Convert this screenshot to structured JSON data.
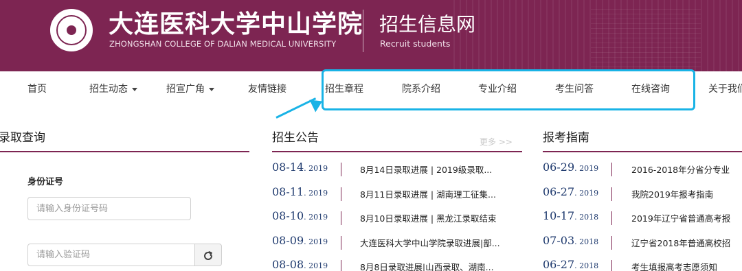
{
  "header": {
    "school_name_cn": "大连医科大学中山学院",
    "school_name_en": "ZHONGSHAN COLLEGE OF DALIAN MEDICAL UNIVERSITY",
    "site_title": "招生信息网",
    "site_subtitle": "Recruit students",
    "brand_color": "#7d2552"
  },
  "nav": {
    "items": [
      {
        "label": "首页",
        "dropdown": false
      },
      {
        "label": "招生动态",
        "dropdown": true
      },
      {
        "label": "招宣广角",
        "dropdown": true
      },
      {
        "label": "友情链接",
        "dropdown": false
      },
      {
        "label": "招生章程",
        "dropdown": false
      },
      {
        "label": "院系介绍",
        "dropdown": false
      },
      {
        "label": "专业介绍",
        "dropdown": false
      },
      {
        "label": "考生问答",
        "dropdown": false
      },
      {
        "label": "在线咨询",
        "dropdown": false
      },
      {
        "label": "关于我们",
        "dropdown": false
      }
    ],
    "highlight_color": "#19b3e6"
  },
  "query": {
    "title": "录取查询",
    "id_label": "身份证号",
    "id_placeholder": "请输入身份证号码",
    "captcha_placeholder": "请输入验证码",
    "refresh_icon": "refresh-icon"
  },
  "notices": {
    "title": "招生公告",
    "more": "更多 >>",
    "items": [
      {
        "md": "08-14",
        "year": ". 2019",
        "text": "8月14日录取进展 | 2019级录取..."
      },
      {
        "md": "08-11",
        "year": ". 2019",
        "text": "8月11日录取进展 | 湖南理工征集..."
      },
      {
        "md": "08-10",
        "year": ". 2019",
        "text": "8月10日录取进展 | 黑龙江录取结束"
      },
      {
        "md": "08-09",
        "year": ". 2019",
        "text": "大连医科大学中山学院录取进展|部..."
      },
      {
        "md": "08-08",
        "year": ". 2019",
        "text": "8月8日录取进展|山西录取、湖南..."
      }
    ]
  },
  "guide": {
    "title": "报考指南",
    "items": [
      {
        "md": "06-29",
        "year": ". 2019",
        "text": "2016-2018年分省分专业"
      },
      {
        "md": "06-27",
        "year": ". 2019",
        "text": "我院2019年报考指南"
      },
      {
        "md": "10-17",
        "year": ". 2018",
        "text": "2019年辽宁省普通高考报"
      },
      {
        "md": "07-03",
        "year": ". 2018",
        "text": "辽宁省2018年普通高校招"
      },
      {
        "md": "06-27",
        "year": ". 2018",
        "text": "考生填报高考志愿须知"
      }
    ]
  }
}
